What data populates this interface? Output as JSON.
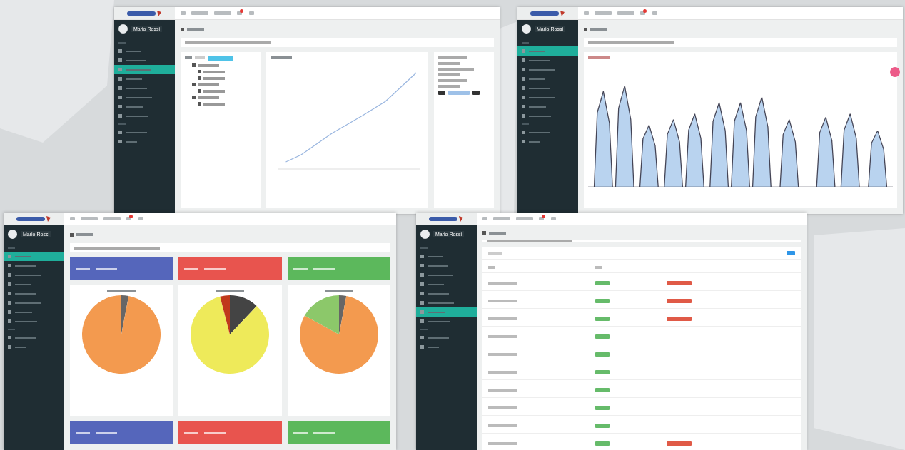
{
  "windows": [
    {
      "kind": "tree-chart",
      "user": "Mario Rossi",
      "sidebar": [
        {
          "selected": false
        },
        {
          "selected": false
        },
        {
          "selected": true
        },
        {
          "selected": false
        },
        {
          "selected": false
        },
        {
          "selected": false
        },
        {
          "selected": false
        },
        {
          "selected": false
        }
      ]
    },
    {
      "kind": "area-chart",
      "user": "Mario Rossi",
      "sidebar": [
        {
          "selected": true
        },
        {
          "selected": false
        },
        {
          "selected": false
        },
        {
          "selected": false
        },
        {
          "selected": false
        },
        {
          "selected": false
        },
        {
          "selected": false
        },
        {
          "selected": false
        }
      ]
    },
    {
      "kind": "dashboard",
      "user": "Mario Rossi",
      "sidebar": [
        {
          "selected": true
        },
        {
          "selected": false
        },
        {
          "selected": false
        },
        {
          "selected": false
        },
        {
          "selected": false
        },
        {
          "selected": false
        },
        {
          "selected": false
        },
        {
          "selected": false
        }
      ],
      "cards": [
        {
          "color": "#5566bb"
        },
        {
          "color": "#e8544e"
        },
        {
          "color": "#5cb85c"
        }
      ]
    },
    {
      "kind": "table",
      "user": "Mario Rossi",
      "sidebar": [
        {
          "selected": false
        },
        {
          "selected": false
        },
        {
          "selected": false
        },
        {
          "selected": false
        },
        {
          "selected": false
        },
        {
          "selected": false
        },
        {
          "selected": true
        },
        {
          "selected": false
        }
      ],
      "rows": [
        {
          "alarm": true
        },
        {
          "alarm": true
        },
        {
          "alarm": true
        },
        {
          "alarm": false
        },
        {
          "alarm": false
        },
        {
          "alarm": false
        },
        {
          "alarm": false
        },
        {
          "alarm": false
        },
        {
          "alarm": false
        },
        {
          "alarm": true
        }
      ]
    }
  ]
}
